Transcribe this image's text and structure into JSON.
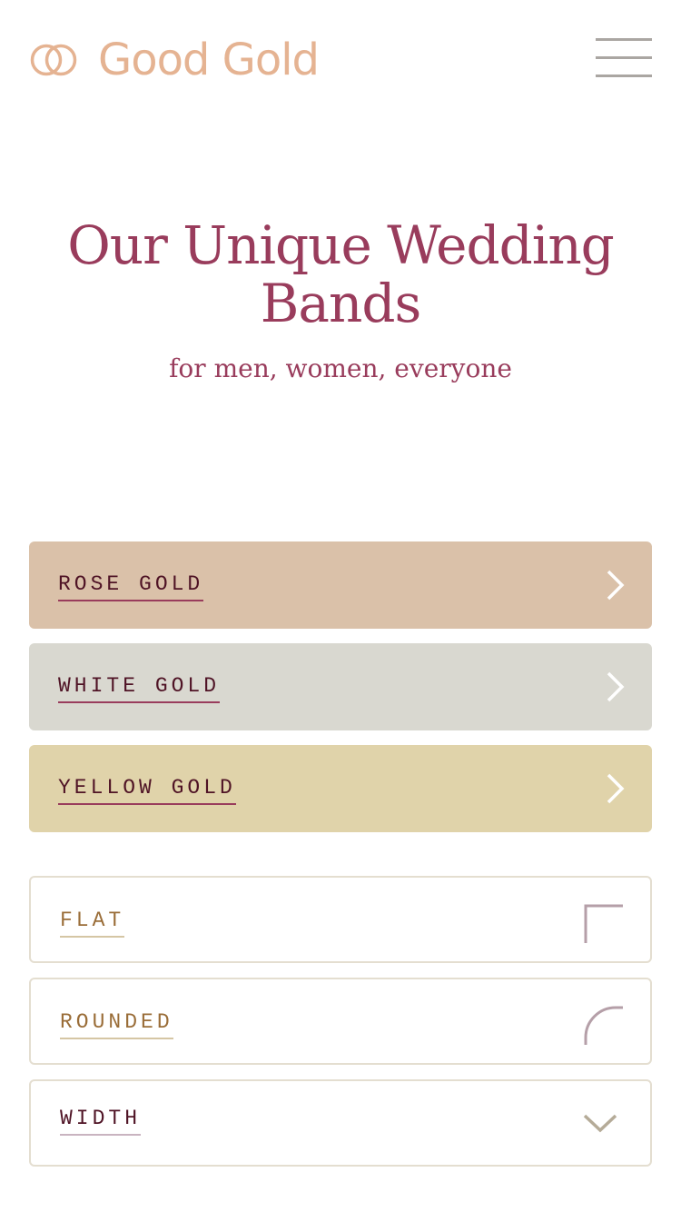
{
  "header": {
    "brand_name": "Good Gold",
    "logo_icon": "interlocking-rings-icon",
    "menu_icon": "hamburger-icon",
    "brand_color": "#e5b392"
  },
  "hero": {
    "title": "Our Unique Wedding Bands",
    "subtitle": "for men, women, everyone",
    "title_color": "#993c5c"
  },
  "metals": [
    {
      "label": "ROSE GOLD",
      "color": "#dac1a9",
      "icon": "chevron-right-icon"
    },
    {
      "label": "WHITE GOLD",
      "color": "#d9d8d0",
      "icon": "chevron-right-icon"
    },
    {
      "label": "YELLOW GOLD",
      "color": "#e0d3aa",
      "icon": "chevron-right-icon"
    }
  ],
  "profiles": [
    {
      "label": "FLAT",
      "icon": "flat-profile-icon"
    },
    {
      "label": "ROUNDED",
      "icon": "rounded-profile-icon"
    }
  ],
  "width_dropdown": {
    "label": "WIDTH",
    "icon": "chevron-down-icon"
  }
}
